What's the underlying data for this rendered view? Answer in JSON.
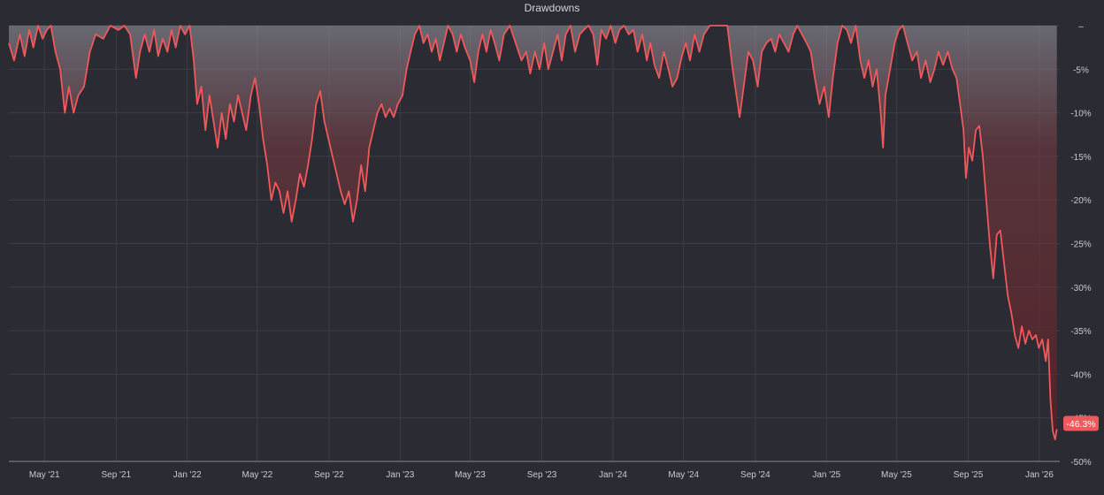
{
  "colors": {
    "background": "#2b2b33",
    "line": "#f0595b",
    "grid": "#3d3d47",
    "text": "#c9c9cf",
    "badge": "#f0595b",
    "badge_text": "#ffffff"
  },
  "chart_data": {
    "type": "area",
    "title": "Drawdowns",
    "xlabel": "",
    "ylabel": "",
    "x_axis": "date",
    "xlim": [
      "2021-03-01",
      "2026-02-05"
    ],
    "ylim": [
      -50,
      0
    ],
    "grid": true,
    "y_axis_side": "right",
    "x_ticks": [
      {
        "date": "2021-05-01",
        "label": "May '21"
      },
      {
        "date": "2021-09-01",
        "label": "Sep '21"
      },
      {
        "date": "2022-01-01",
        "label": "Jan '22"
      },
      {
        "date": "2022-05-01",
        "label": "May '22"
      },
      {
        "date": "2022-09-01",
        "label": "Sep '22"
      },
      {
        "date": "2023-01-01",
        "label": "Jan '23"
      },
      {
        "date": "2023-05-01",
        "label": "May '23"
      },
      {
        "date": "2023-09-01",
        "label": "Sep '23"
      },
      {
        "date": "2024-01-01",
        "label": "Jan '24"
      },
      {
        "date": "2024-05-01",
        "label": "May '24"
      },
      {
        "date": "2024-09-01",
        "label": "Sep '24"
      },
      {
        "date": "2025-01-01",
        "label": "Jan '25"
      },
      {
        "date": "2025-05-01",
        "label": "May '25"
      },
      {
        "date": "2025-09-01",
        "label": "Sep '25"
      },
      {
        "date": "2026-01-01",
        "label": "Jan '26"
      }
    ],
    "y_ticks": [
      {
        "value": 0,
        "label": "–"
      },
      {
        "value": -5,
        "label": "-5%"
      },
      {
        "value": -10,
        "label": "-10%"
      },
      {
        "value": -15,
        "label": "-15%"
      },
      {
        "value": -20,
        "label": "-20%"
      },
      {
        "value": -25,
        "label": "-25%"
      },
      {
        "value": -30,
        "label": "-30%"
      },
      {
        "value": -35,
        "label": "-35%"
      },
      {
        "value": -40,
        "label": "-40%"
      },
      {
        "value": -45,
        "label": "-45%"
      },
      {
        "value": -50,
        "label": "-50%"
      }
    ],
    "last_value_label": "-46.3%",
    "series": [
      {
        "values": [
          [
            "2021-03-01",
            -2.0
          ],
          [
            "2021-03-10",
            -4.0
          ],
          [
            "2021-03-20",
            -1.0
          ],
          [
            "2021-03-28",
            -3.5
          ],
          [
            "2021-04-05",
            -0.5
          ],
          [
            "2021-04-12",
            -2.5
          ],
          [
            "2021-04-20",
            0.0
          ],
          [
            "2021-04-28",
            -1.5
          ],
          [
            "2021-05-05",
            -0.5
          ],
          [
            "2021-05-12",
            0.0
          ],
          [
            "2021-05-20",
            -3.0
          ],
          [
            "2021-05-28",
            -5.0
          ],
          [
            "2021-06-05",
            -10.0
          ],
          [
            "2021-06-12",
            -7.0
          ],
          [
            "2021-06-20",
            -10.0
          ],
          [
            "2021-06-28",
            -8.0
          ],
          [
            "2021-07-08",
            -7.0
          ],
          [
            "2021-07-18",
            -3.0
          ],
          [
            "2021-07-28",
            -1.0
          ],
          [
            "2021-08-10",
            -1.5
          ],
          [
            "2021-08-22",
            0.0
          ],
          [
            "2021-09-05",
            -0.5
          ],
          [
            "2021-09-15",
            0.0
          ],
          [
            "2021-09-25",
            -1.0
          ],
          [
            "2021-10-05",
            -6.0
          ],
          [
            "2021-10-12",
            -3.0
          ],
          [
            "2021-10-20",
            -1.0
          ],
          [
            "2021-10-28",
            -3.0
          ],
          [
            "2021-11-05",
            -0.5
          ],
          [
            "2021-11-12",
            -3.5
          ],
          [
            "2021-11-20",
            -1.5
          ],
          [
            "2021-11-28",
            -3.0
          ],
          [
            "2021-12-05",
            -0.5
          ],
          [
            "2021-12-12",
            -2.5
          ],
          [
            "2021-12-20",
            0.0
          ],
          [
            "2021-12-28",
            -1.0
          ],
          [
            "2022-01-05",
            0.0
          ],
          [
            "2022-01-12",
            -4.0
          ],
          [
            "2022-01-18",
            -9.0
          ],
          [
            "2022-01-25",
            -7.0
          ],
          [
            "2022-02-01",
            -12.0
          ],
          [
            "2022-02-08",
            -8.0
          ],
          [
            "2022-02-15",
            -11.0
          ],
          [
            "2022-02-22",
            -14.0
          ],
          [
            "2022-03-01",
            -10.0
          ],
          [
            "2022-03-08",
            -13.0
          ],
          [
            "2022-03-15",
            -9.0
          ],
          [
            "2022-03-22",
            -11.0
          ],
          [
            "2022-03-29",
            -8.0
          ],
          [
            "2022-04-05",
            -10.0
          ],
          [
            "2022-04-12",
            -12.0
          ],
          [
            "2022-04-20",
            -8.0
          ],
          [
            "2022-04-27",
            -6.0
          ],
          [
            "2022-05-04",
            -9.0
          ],
          [
            "2022-05-11",
            -13.0
          ],
          [
            "2022-05-18",
            -16.0
          ],
          [
            "2022-05-25",
            -20.0
          ],
          [
            "2022-06-01",
            -18.0
          ],
          [
            "2022-06-08",
            -19.0
          ],
          [
            "2022-06-15",
            -21.5
          ],
          [
            "2022-06-22",
            -19.0
          ],
          [
            "2022-06-29",
            -22.5
          ],
          [
            "2022-07-06",
            -20.0
          ],
          [
            "2022-07-13",
            -17.0
          ],
          [
            "2022-07-20",
            -18.5
          ],
          [
            "2022-07-27",
            -16.0
          ],
          [
            "2022-08-03",
            -13.0
          ],
          [
            "2022-08-10",
            -9.0
          ],
          [
            "2022-08-17",
            -7.5
          ],
          [
            "2022-08-24",
            -11.0
          ],
          [
            "2022-08-31",
            -13.0
          ],
          [
            "2022-09-07",
            -15.0
          ],
          [
            "2022-09-14",
            -17.0
          ],
          [
            "2022-09-21",
            -19.0
          ],
          [
            "2022-09-28",
            -20.5
          ],
          [
            "2022-10-05",
            -19.0
          ],
          [
            "2022-10-12",
            -22.5
          ],
          [
            "2022-10-19",
            -20.0
          ],
          [
            "2022-10-26",
            -16.0
          ],
          [
            "2022-11-02",
            -19.0
          ],
          [
            "2022-11-09",
            -14.0
          ],
          [
            "2022-11-16",
            -12.0
          ],
          [
            "2022-11-23",
            -10.0
          ],
          [
            "2022-11-30",
            -9.0
          ],
          [
            "2022-12-07",
            -10.5
          ],
          [
            "2022-12-14",
            -9.5
          ],
          [
            "2022-12-21",
            -10.5
          ],
          [
            "2022-12-28",
            -9.0
          ],
          [
            "2023-01-05",
            -8.0
          ],
          [
            "2023-01-12",
            -5.0
          ],
          [
            "2023-01-19",
            -3.0
          ],
          [
            "2023-01-26",
            -1.0
          ],
          [
            "2023-02-03",
            0.0
          ],
          [
            "2023-02-10",
            -2.0
          ],
          [
            "2023-02-17",
            -1.0
          ],
          [
            "2023-02-24",
            -3.0
          ],
          [
            "2023-03-03",
            -1.5
          ],
          [
            "2023-03-10",
            -4.0
          ],
          [
            "2023-03-17",
            -2.0
          ],
          [
            "2023-03-24",
            0.0
          ],
          [
            "2023-04-01",
            -1.0
          ],
          [
            "2023-04-08",
            -3.0
          ],
          [
            "2023-04-15",
            -1.0
          ],
          [
            "2023-04-22",
            -2.5
          ],
          [
            "2023-05-01",
            -4.0
          ],
          [
            "2023-05-08",
            -6.5
          ],
          [
            "2023-05-15",
            -3.0
          ],
          [
            "2023-05-22",
            -1.0
          ],
          [
            "2023-05-29",
            -3.0
          ],
          [
            "2023-06-05",
            -0.5
          ],
          [
            "2023-06-12",
            -2.0
          ],
          [
            "2023-06-20",
            -4.0
          ],
          [
            "2023-06-28",
            -1.0
          ],
          [
            "2023-07-08",
            0.0
          ],
          [
            "2023-07-18",
            -2.0
          ],
          [
            "2023-07-28",
            -4.0
          ],
          [
            "2023-08-05",
            -3.0
          ],
          [
            "2023-08-12",
            -5.5
          ],
          [
            "2023-08-20",
            -3.0
          ],
          [
            "2023-08-28",
            -5.0
          ],
          [
            "2023-09-05",
            -2.0
          ],
          [
            "2023-09-12",
            -5.0
          ],
          [
            "2023-09-20",
            -3.0
          ],
          [
            "2023-09-28",
            -1.0
          ],
          [
            "2023-10-05",
            -4.0
          ],
          [
            "2023-10-12",
            -1.0
          ],
          [
            "2023-10-20",
            0.0
          ],
          [
            "2023-10-28",
            -3.0
          ],
          [
            "2023-11-05",
            -1.0
          ],
          [
            "2023-11-12",
            -0.5
          ],
          [
            "2023-11-20",
            0.0
          ],
          [
            "2023-11-28",
            -1.0
          ],
          [
            "2023-12-05",
            -4.5
          ],
          [
            "2023-12-12",
            -0.5
          ],
          [
            "2023-12-20",
            -1.5
          ],
          [
            "2023-12-28",
            0.0
          ],
          [
            "2024-01-05",
            -2.0
          ],
          [
            "2024-01-12",
            -0.5
          ],
          [
            "2024-01-20",
            0.0
          ],
          [
            "2024-01-28",
            -1.0
          ],
          [
            "2024-02-05",
            -0.5
          ],
          [
            "2024-02-12",
            -3.0
          ],
          [
            "2024-02-20",
            -1.0
          ],
          [
            "2024-02-28",
            -4.0
          ],
          [
            "2024-03-05",
            -2.0
          ],
          [
            "2024-03-12",
            -4.5
          ],
          [
            "2024-03-20",
            -6.0
          ],
          [
            "2024-03-28",
            -3.0
          ],
          [
            "2024-04-05",
            -5.0
          ],
          [
            "2024-04-12",
            -7.0
          ],
          [
            "2024-04-20",
            -6.0
          ],
          [
            "2024-04-28",
            -3.5
          ],
          [
            "2024-05-05",
            -2.0
          ],
          [
            "2024-05-12",
            -4.0
          ],
          [
            "2024-05-20",
            -1.0
          ],
          [
            "2024-05-28",
            -3.0
          ],
          [
            "2024-06-05",
            -1.0
          ],
          [
            "2024-06-15",
            0.0
          ],
          [
            "2024-06-25",
            0.0
          ],
          [
            "2024-07-05",
            0.0
          ],
          [
            "2024-07-15",
            0.0
          ],
          [
            "2024-07-24",
            -5.0
          ],
          [
            "2024-08-05",
            -10.5
          ],
          [
            "2024-08-12",
            -7.0
          ],
          [
            "2024-08-20",
            -3.0
          ],
          [
            "2024-08-28",
            -4.0
          ],
          [
            "2024-09-05",
            -7.0
          ],
          [
            "2024-09-12",
            -3.0
          ],
          [
            "2024-09-20",
            -2.0
          ],
          [
            "2024-09-28",
            -1.5
          ],
          [
            "2024-10-05",
            -3.0
          ],
          [
            "2024-10-12",
            -1.0
          ],
          [
            "2024-10-20",
            -2.0
          ],
          [
            "2024-10-28",
            -3.0
          ],
          [
            "2024-11-05",
            -1.0
          ],
          [
            "2024-11-12",
            0.0
          ],
          [
            "2024-11-20",
            -1.0
          ],
          [
            "2024-11-28",
            -2.0
          ],
          [
            "2024-12-05",
            -3.0
          ],
          [
            "2024-12-12",
            -6.0
          ],
          [
            "2024-12-20",
            -9.0
          ],
          [
            "2024-12-28",
            -7.0
          ],
          [
            "2025-01-05",
            -10.5
          ],
          [
            "2025-01-12",
            -6.0
          ],
          [
            "2025-01-20",
            -2.0
          ],
          [
            "2025-01-28",
            0.0
          ],
          [
            "2025-02-05",
            -0.5
          ],
          [
            "2025-02-12",
            -2.0
          ],
          [
            "2025-02-20",
            0.0
          ],
          [
            "2025-02-28",
            -4.0
          ],
          [
            "2025-03-07",
            -6.0
          ],
          [
            "2025-03-14",
            -4.0
          ],
          [
            "2025-03-21",
            -7.0
          ],
          [
            "2025-03-28",
            -5.0
          ],
          [
            "2025-04-04",
            -10.0
          ],
          [
            "2025-04-08",
            -14.0
          ],
          [
            "2025-04-12",
            -8.0
          ],
          [
            "2025-04-20",
            -5.0
          ],
          [
            "2025-04-28",
            -2.0
          ],
          [
            "2025-05-05",
            -0.5
          ],
          [
            "2025-05-12",
            0.0
          ],
          [
            "2025-05-20",
            -2.0
          ],
          [
            "2025-05-28",
            -4.0
          ],
          [
            "2025-06-05",
            -3.0
          ],
          [
            "2025-06-12",
            -6.0
          ],
          [
            "2025-06-20",
            -4.0
          ],
          [
            "2025-06-28",
            -6.5
          ],
          [
            "2025-07-05",
            -5.0
          ],
          [
            "2025-07-12",
            -3.0
          ],
          [
            "2025-07-20",
            -4.5
          ],
          [
            "2025-07-28",
            -3.0
          ],
          [
            "2025-08-05",
            -5.0
          ],
          [
            "2025-08-12",
            -6.0
          ],
          [
            "2025-08-18",
            -9.0
          ],
          [
            "2025-08-24",
            -12.0
          ],
          [
            "2025-08-28",
            -17.5
          ],
          [
            "2025-09-02",
            -14.0
          ],
          [
            "2025-09-08",
            -15.5
          ],
          [
            "2025-09-14",
            -12.0
          ],
          [
            "2025-09-20",
            -11.5
          ],
          [
            "2025-09-26",
            -15.0
          ],
          [
            "2025-10-02",
            -20.0
          ],
          [
            "2025-10-08",
            -25.0
          ],
          [
            "2025-10-14",
            -29.0
          ],
          [
            "2025-10-20",
            -24.0
          ],
          [
            "2025-10-26",
            -23.5
          ],
          [
            "2025-11-01",
            -27.0
          ],
          [
            "2025-11-08",
            -31.0
          ],
          [
            "2025-11-14",
            -33.0
          ],
          [
            "2025-11-20",
            -35.5
          ],
          [
            "2025-11-26",
            -37.0
          ],
          [
            "2025-12-02",
            -34.5
          ],
          [
            "2025-12-08",
            -36.5
          ],
          [
            "2025-12-14",
            -35.0
          ],
          [
            "2025-12-20",
            -36.0
          ],
          [
            "2025-12-26",
            -35.5
          ],
          [
            "2025-12-31",
            -37.0
          ],
          [
            "2026-01-06",
            -36.0
          ],
          [
            "2026-01-12",
            -38.5
          ],
          [
            "2026-01-16",
            -36.0
          ],
          [
            "2026-01-20",
            -43.0
          ],
          [
            "2026-01-24",
            -46.5
          ],
          [
            "2026-01-28",
            -47.5
          ],
          [
            "2026-01-31",
            -46.3
          ]
        ]
      }
    ]
  }
}
